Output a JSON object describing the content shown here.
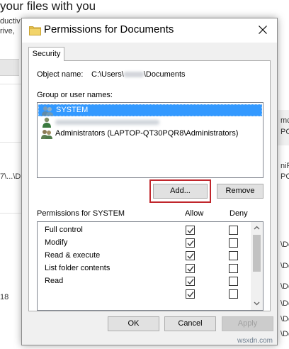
{
  "background": {
    "heading": "your files with you",
    "fragments": [
      "ductiv",
      "rive,",
      "7\\...\\D",
      "18",
      "mc",
      "PC",
      "niP",
      "PC",
      "\\De",
      "\\De",
      "\\De",
      "\\De",
      "\\De",
      "\\De"
    ]
  },
  "dialog": {
    "title": "Permissions for Documents",
    "tab_label": "Security",
    "object_name_label": "Object name:",
    "object_name_value_prefix": "C:\\Users\\",
    "object_name_value_suffix": "\\Documents",
    "group_label": "Group or user names:",
    "users": [
      {
        "name": "SYSTEM",
        "icon": "users-icon",
        "selected": true
      },
      {
        "name": "",
        "icon": "user-icon",
        "selected": false,
        "redacted": true
      },
      {
        "name": "Administrators (LAPTOP-QT30PQR8\\Administrators)",
        "icon": "users-icon",
        "selected": false
      }
    ],
    "add_label": "Add...",
    "remove_label": "Remove",
    "perm_label": "Permissions for SYSTEM",
    "allow_label": "Allow",
    "deny_label": "Deny",
    "permissions": [
      {
        "name": "Full control",
        "allow": true,
        "deny": false
      },
      {
        "name": "Modify",
        "allow": true,
        "deny": false
      },
      {
        "name": "Read & execute",
        "allow": true,
        "deny": false
      },
      {
        "name": "List folder contents",
        "allow": true,
        "deny": false
      },
      {
        "name": "Read",
        "allow": true,
        "deny": false
      }
    ],
    "ok_label": "OK",
    "cancel_label": "Cancel",
    "apply_label": "Apply"
  },
  "watermark": "wsxdn.com",
  "colors": {
    "selection": "#3399ff",
    "highlight": "#c0262c",
    "folder": "#e8c34a"
  }
}
